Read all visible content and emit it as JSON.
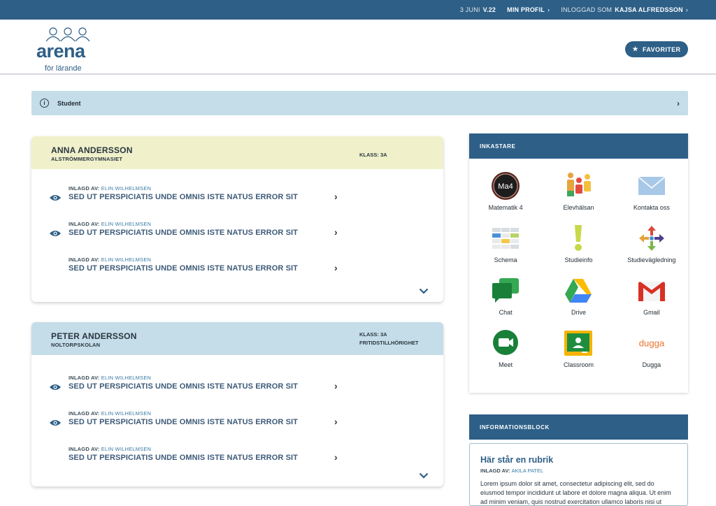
{
  "topbar": {
    "date_prefix": "3 JUNI",
    "week": "V.22",
    "profile": "MIN PROFIL",
    "logged_in_prefix": "INLOGGAD SOM",
    "user": "KAJSA ALFREDSSON"
  },
  "header": {
    "logo_word": "arena",
    "logo_sub": "för lärande",
    "favorites": "FAVORITER"
  },
  "student_bar": {
    "label": "Student"
  },
  "students": [
    {
      "name": "ANNA ANDERSSON",
      "school": "ALSTRÖMMERGYMNASIET",
      "klass": "KLASS: 3A",
      "extra": "",
      "posts": [
        {
          "by_prefix": "INLAGD AV:",
          "author": "ELIN WILHELMSEN",
          "title": "SED UT PERSPICIATIS UNDE OMNIS ISTE NATUS ERROR SIT",
          "seen": true
        },
        {
          "by_prefix": "INLAGD AV:",
          "author": "ELIN WILHELMSEN",
          "title": "SED UT PERSPICIATIS UNDE OMNIS ISTE NATUS ERROR SIT",
          "seen": true
        },
        {
          "by_prefix": "INLAGD AV:",
          "author": "ELIN WILHELMSEN",
          "title": "SED UT PERSPICIATIS UNDE OMNIS ISTE NATUS ERROR SIT",
          "seen": false
        }
      ]
    },
    {
      "name": "PETER ANDERSSON",
      "school": "NOLTORPSKOLAN",
      "klass": "KLASS: 3A",
      "extra": "FRITIDSTILLHÖRIGHET",
      "posts": [
        {
          "by_prefix": "INLAGD AV:",
          "author": "ELIN WILHELMSEN",
          "title": "SED UT PERSPICIATIS UNDE OMNIS ISTE NATUS ERROR SIT",
          "seen": true
        },
        {
          "by_prefix": "INLAGD AV:",
          "author": "ELIN WILHELMSEN",
          "title": "SED UT PERSPICIATIS UNDE OMNIS ISTE NATUS ERROR SIT",
          "seen": true
        },
        {
          "by_prefix": "INLAGD AV:",
          "author": "ELIN WILHELMSEN",
          "title": "SED UT PERSPICIATIS UNDE OMNIS ISTE NATUS ERROR SIT",
          "seen": false
        }
      ]
    }
  ],
  "inkastare": {
    "title": "INKASTARE",
    "apps": [
      {
        "label": "Matematik 4",
        "icon": "ma4-icon",
        "badge": "Ma4"
      },
      {
        "label": "Elevhälsan",
        "icon": "people-icon"
      },
      {
        "label": "Kontakta oss",
        "icon": "envelope-icon"
      },
      {
        "label": "Schema",
        "icon": "schedule-icon"
      },
      {
        "label": "Studieinfo",
        "icon": "exclamation-icon"
      },
      {
        "label": "Studievägledning",
        "icon": "arrows-icon"
      },
      {
        "label": "Chat",
        "icon": "chat-icon"
      },
      {
        "label": "Drive",
        "icon": "drive-icon"
      },
      {
        "label": "Gmail",
        "icon": "gmail-icon"
      },
      {
        "label": "Meet",
        "icon": "meet-icon"
      },
      {
        "label": "Classroom",
        "icon": "classroom-icon"
      },
      {
        "label": "Dugga",
        "icon": "dugga-icon",
        "badge": "dugga"
      }
    ]
  },
  "informationsblock": {
    "title": "INFORMATIONSBLOCK",
    "heading": "Här står en rubrik",
    "by_prefix": "INLAGD AV:",
    "author": "AKILA PATEL",
    "text": "Lorem ipsum dolor sit amet, consectetur adipiscing elit, sed do eiusmod tempor incididunt ut labore et dolore magna aliqua. Ut enim ad minim veniam, quis nostrud exercitation ullamco laboris nisi ut aliquip."
  },
  "colors": {
    "brand": "#2d5f87",
    "student_bar": "#c4dde8",
    "card1_head": "#f0f1cb",
    "card2_head": "#c4dde8"
  }
}
